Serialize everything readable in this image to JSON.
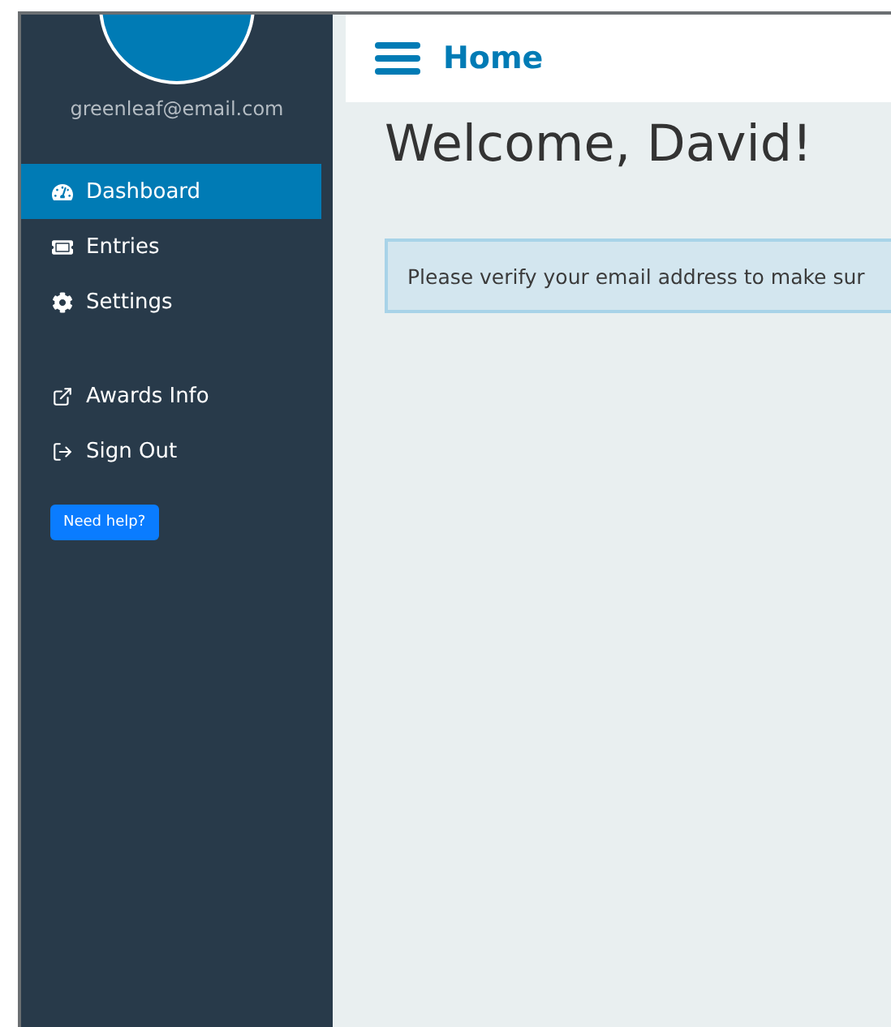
{
  "sidebar": {
    "email": "greenleaf@email.com",
    "items": [
      {
        "label": "Dashboard",
        "kind": "gauge",
        "selected": true
      },
      {
        "label": "Entries",
        "kind": "ticket",
        "selected": false
      },
      {
        "label": "Settings",
        "kind": "gear",
        "selected": false
      }
    ],
    "links": [
      {
        "label": "Awards Info",
        "kind": "external"
      },
      {
        "label": "Sign Out",
        "kind": "signout"
      }
    ],
    "help_button": "Need help?"
  },
  "header": {
    "title": "Home"
  },
  "main": {
    "heading": "Welcome, David!",
    "alert": "Please verify your email address to make sur"
  }
}
